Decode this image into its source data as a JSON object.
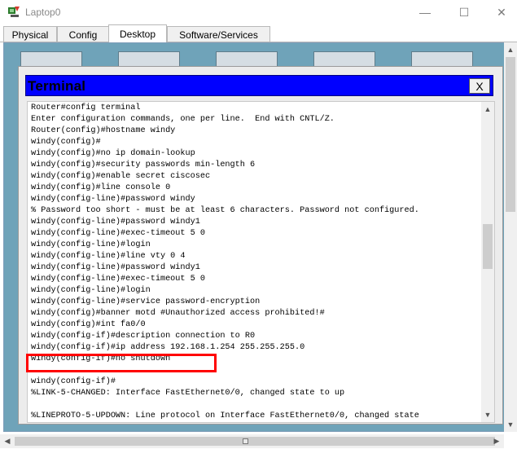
{
  "window": {
    "title": "Laptop0",
    "min_glyph": "—",
    "max_glyph": "☐",
    "close_glyph": "✕"
  },
  "tabs": [
    {
      "label": "Physical"
    },
    {
      "label": "Config"
    },
    {
      "label": "Desktop"
    },
    {
      "label": "Software/Services"
    }
  ],
  "active_tab": "Desktop",
  "terminal": {
    "title": "Terminal",
    "close_label": "X",
    "lines": [
      "Router#config terminal",
      "Enter configuration commands, one per line.  End with CNTL/Z.",
      "Router(config)#hostname windy",
      "windy(config)#",
      "windy(config)#no ip domain-lookup",
      "windy(config)#security passwords min-length 6",
      "windy(config)#enable secret ciscosec",
      "windy(config)#line console 0",
      "windy(config-line)#password windy",
      "% Password too short - must be at least 6 characters. Password not configured.",
      "windy(config-line)#password windy1",
      "windy(config-line)#exec-timeout 5 0",
      "windy(config-line)#login",
      "windy(config-line)#line vty 0 4",
      "windy(config-line)#password windy1",
      "windy(config-line)#exec-timeout 5 0",
      "windy(config-line)#login",
      "windy(config-line)#service password-encryption",
      "windy(config)#banner motd #Unauthorized access prohibited!#",
      "windy(config)#int fa0/0",
      "windy(config-if)#description connection to R0",
      "windy(config-if)#ip address 192.168.1.254 255.255.255.0",
      "windy(config-if)#no shutdown",
      "",
      "windy(config-if)#",
      "%LINK-5-CHANGED: Interface FastEthernet0/0, changed state to up",
      "",
      "%LINEPROTO-5-UPDOWN: Line protocol on Interface FastEthernet0/0, changed state"
    ]
  },
  "colors": {
    "terminal_title_bg": "#0000ff",
    "desktop_bg": "#6fa3b9",
    "highlight_border": "#ff0000"
  },
  "icons": {
    "app": "packet-tracer-laptop-icon",
    "scroll_up": "▲",
    "scroll_down": "▼",
    "scroll_left": "◀",
    "scroll_right": "▶"
  }
}
